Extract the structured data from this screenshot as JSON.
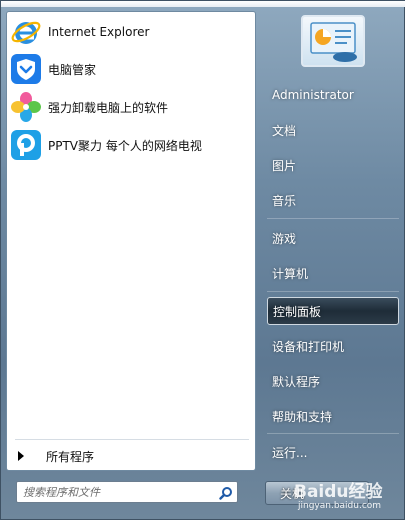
{
  "pinned_programs": [
    {
      "label": "Internet Explorer",
      "icon": "internet-explorer-icon"
    },
    {
      "label": "电脑管家",
      "icon": "pc-manager-shield-icon"
    },
    {
      "label": "强力卸载电脑上的软件",
      "icon": "uninstall-pinwheel-icon"
    },
    {
      "label": "PPTV聚力 每个人的网络电视",
      "icon": "pptv-icon"
    }
  ],
  "all_programs_label": "所有程序",
  "search": {
    "placeholder": "搜索程序和文件"
  },
  "right_items": [
    {
      "label": "Administrator"
    },
    {
      "label": "文档"
    },
    {
      "label": "图片"
    },
    {
      "label": "音乐"
    },
    {
      "label": "游戏"
    },
    {
      "label": "计算机"
    },
    {
      "label": "控制面板",
      "highlighted": true
    },
    {
      "label": "设备和打印机"
    },
    {
      "label": "默认程序"
    },
    {
      "label": "帮助和支持"
    },
    {
      "label": "运行..."
    }
  ],
  "shutdown_label": "关机",
  "watermark": {
    "text": "Baidu经验",
    "sub": "jingyan.baidu.com"
  }
}
